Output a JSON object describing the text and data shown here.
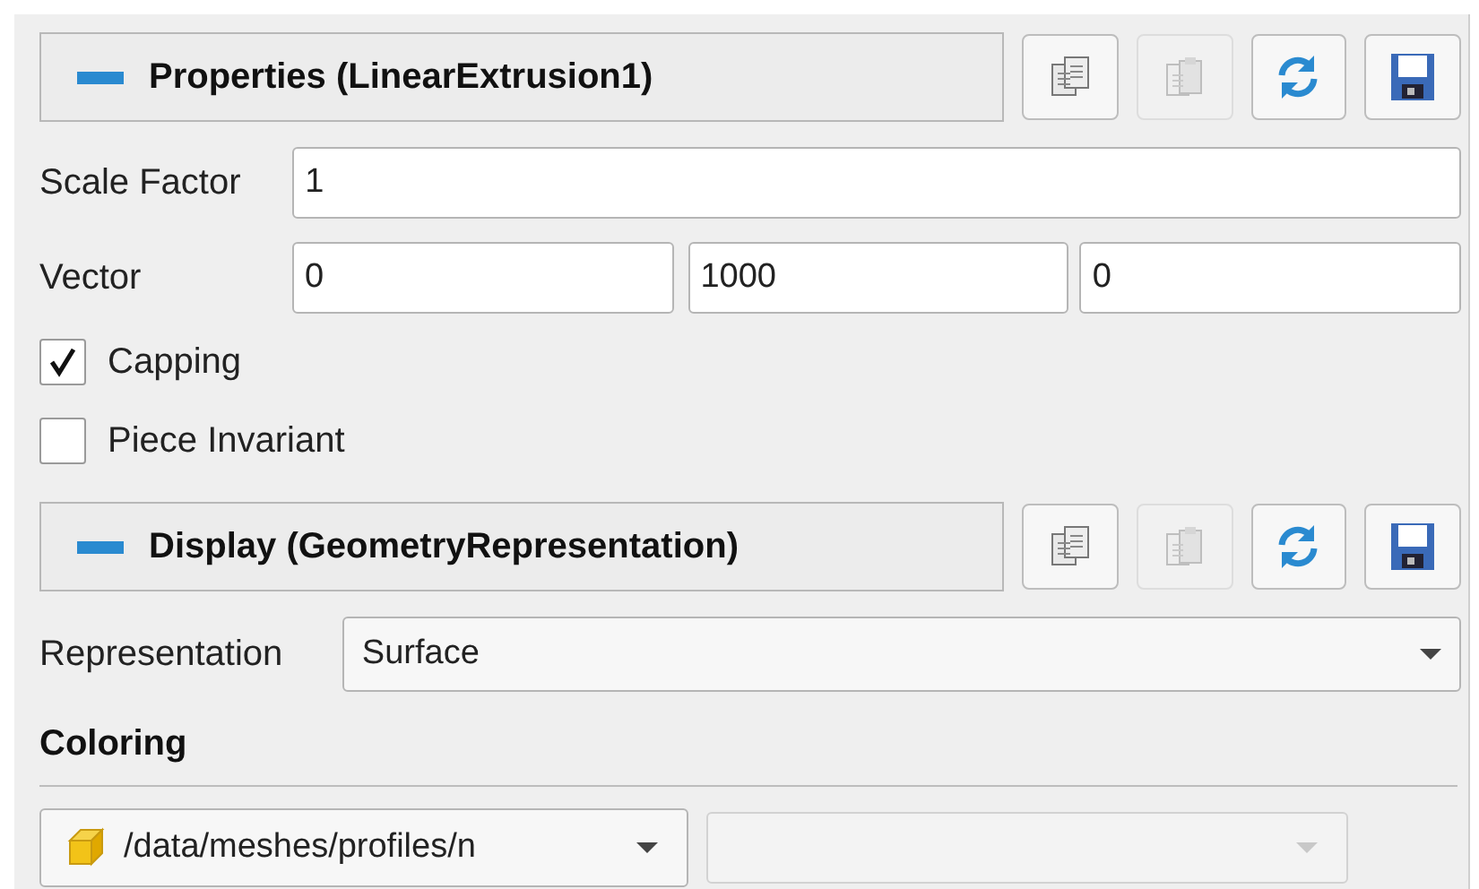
{
  "properties_header": {
    "title": "Properties (LinearExtrusion1)",
    "expanded": true,
    "buttons": [
      {
        "kind": "copy",
        "disabled": false
      },
      {
        "kind": "paste",
        "disabled": true
      },
      {
        "kind": "reload",
        "disabled": false
      },
      {
        "kind": "save",
        "disabled": false
      }
    ]
  },
  "scale_factor": {
    "label": "Scale Factor",
    "value": "1"
  },
  "vector": {
    "label": "Vector",
    "values": [
      "0",
      "1000",
      "0"
    ]
  },
  "checkboxes": [
    {
      "label": "Capping",
      "checked": true
    },
    {
      "label": "Piece Invariant",
      "checked": false
    }
  ],
  "display_header": {
    "title": "Display (GeometryRepresentation)",
    "expanded": true,
    "buttons": [
      {
        "kind": "copy",
        "disabled": false
      },
      {
        "kind": "paste",
        "disabled": true
      },
      {
        "kind": "reload",
        "disabled": false
      },
      {
        "kind": "save",
        "disabled": false
      }
    ]
  },
  "representation": {
    "label": "Representation",
    "value": "Surface"
  },
  "coloring": {
    "title": "Coloring",
    "array": {
      "value": "/data/meshes/profiles/n",
      "disabled": false
    },
    "component": {
      "disabled": true
    }
  }
}
